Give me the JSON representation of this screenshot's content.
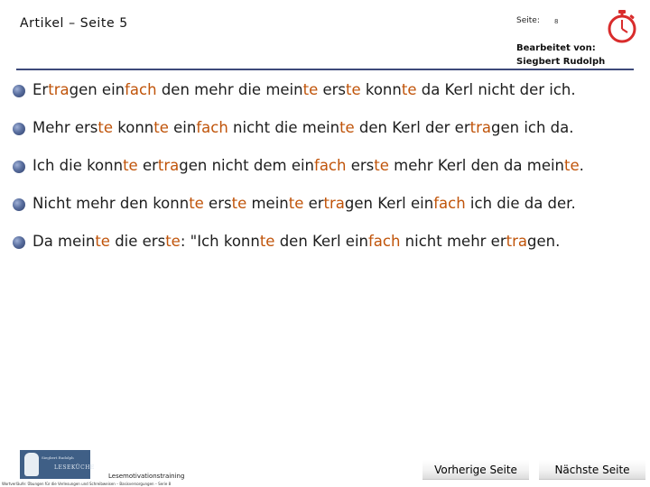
{
  "header": {
    "title": "Artikel – Seite 5",
    "page_label": "Seite:",
    "page_number": "8",
    "editor_label": "Bearbeitet von:",
    "editor_name": "Siegbert Rudolph",
    "accent_color": "#3d4a7a",
    "timer_color": "#d92c2c"
  },
  "content": {
    "highlight_color": "#c0540a",
    "lines": [
      [
        {
          "t": "Er",
          "hl": false
        },
        {
          "t": "tra",
          "hl": true
        },
        {
          "t": "gen ein",
          "hl": false
        },
        {
          "t": "fach",
          "hl": true
        },
        {
          "t": " den mehr die mein",
          "hl": false
        },
        {
          "t": "te",
          "hl": true
        },
        {
          "t": " ers",
          "hl": false
        },
        {
          "t": "te",
          "hl": true
        },
        {
          "t": " konn",
          "hl": false
        },
        {
          "t": "te",
          "hl": true
        },
        {
          "t": " da Kerl nicht der ich.",
          "hl": false
        }
      ],
      [
        {
          "t": "Mehr ers",
          "hl": false
        },
        {
          "t": "te",
          "hl": true
        },
        {
          "t": " konn",
          "hl": false
        },
        {
          "t": "te",
          "hl": true
        },
        {
          "t": " ein",
          "hl": false
        },
        {
          "t": "fach",
          "hl": true
        },
        {
          "t": " nicht die mein",
          "hl": false
        },
        {
          "t": "te",
          "hl": true
        },
        {
          "t": " den Kerl der er",
          "hl": false
        },
        {
          "t": "tra",
          "hl": true
        },
        {
          "t": "gen ich da.",
          "hl": false
        }
      ],
      [
        {
          "t": "Ich die konn",
          "hl": false
        },
        {
          "t": "te",
          "hl": true
        },
        {
          "t": " er",
          "hl": false
        },
        {
          "t": "tra",
          "hl": true
        },
        {
          "t": "gen nicht dem ein",
          "hl": false
        },
        {
          "t": "fach",
          "hl": true
        },
        {
          "t": " ers",
          "hl": false
        },
        {
          "t": "te",
          "hl": true
        },
        {
          "t": " mehr Kerl den da mein",
          "hl": false
        },
        {
          "t": "te",
          "hl": true
        },
        {
          "t": ".",
          "hl": false
        }
      ],
      [
        {
          "t": "Nicht mehr den konn",
          "hl": false
        },
        {
          "t": "te",
          "hl": true
        },
        {
          "t": " ers",
          "hl": false
        },
        {
          "t": "te",
          "hl": true
        },
        {
          "t": " mein",
          "hl": false
        },
        {
          "t": "te",
          "hl": true
        },
        {
          "t": " er",
          "hl": false
        },
        {
          "t": "tra",
          "hl": true
        },
        {
          "t": "gen Kerl ein",
          "hl": false
        },
        {
          "t": "fach",
          "hl": true
        },
        {
          "t": " ich die da der.",
          "hl": false
        }
      ],
      [
        {
          "t": "Da mein",
          "hl": false
        },
        {
          "t": "te",
          "hl": true
        },
        {
          "t": " die ers",
          "hl": false
        },
        {
          "t": "te",
          "hl": true
        },
        {
          "t": ": \"Ich konn",
          "hl": false
        },
        {
          "t": "te",
          "hl": true
        },
        {
          "t": " den Kerl ein",
          "hl": false
        },
        {
          "t": "fach",
          "hl": true
        },
        {
          "t": " nicht mehr er",
          "hl": false
        },
        {
          "t": "tra",
          "hl": true
        },
        {
          "t": "gen.",
          "hl": false
        }
      ]
    ]
  },
  "footer": {
    "logo_line1": "Siegbert Rudolph",
    "logo_line2": "LESEKÜCHE",
    "brand": "Lesemotivationstraining",
    "fine_print": "Wortverläufe: Übungen für die Verlesungen und Schreibweisen – Basisversorgungen – Serie 8",
    "prev_label": "Vorherige Seite",
    "next_label": "Nächste Seite"
  }
}
